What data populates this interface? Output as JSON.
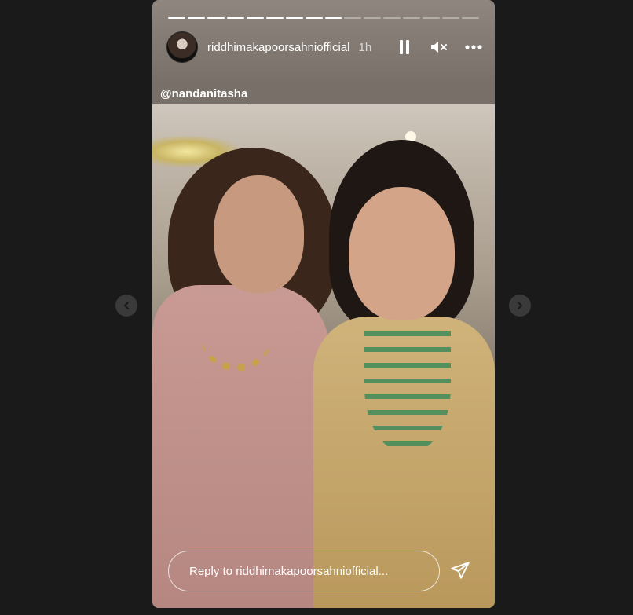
{
  "story": {
    "username": "riddhimakapoorsahniofficial",
    "time": "1h",
    "mention": "@nandanitasha",
    "progress": {
      "total": 16,
      "current": 9
    },
    "reply_placeholder": "Reply to riddhimakapoorsahniofficial..."
  },
  "icons": {
    "pause": "pause-icon",
    "mute": "muted-speaker-icon",
    "more": "more-options-icon",
    "send": "send-icon",
    "prev": "chevron-left-icon",
    "next": "chevron-right-icon"
  },
  "colors": {
    "page_background": "#1a1a1a",
    "text": "#ffffff"
  }
}
